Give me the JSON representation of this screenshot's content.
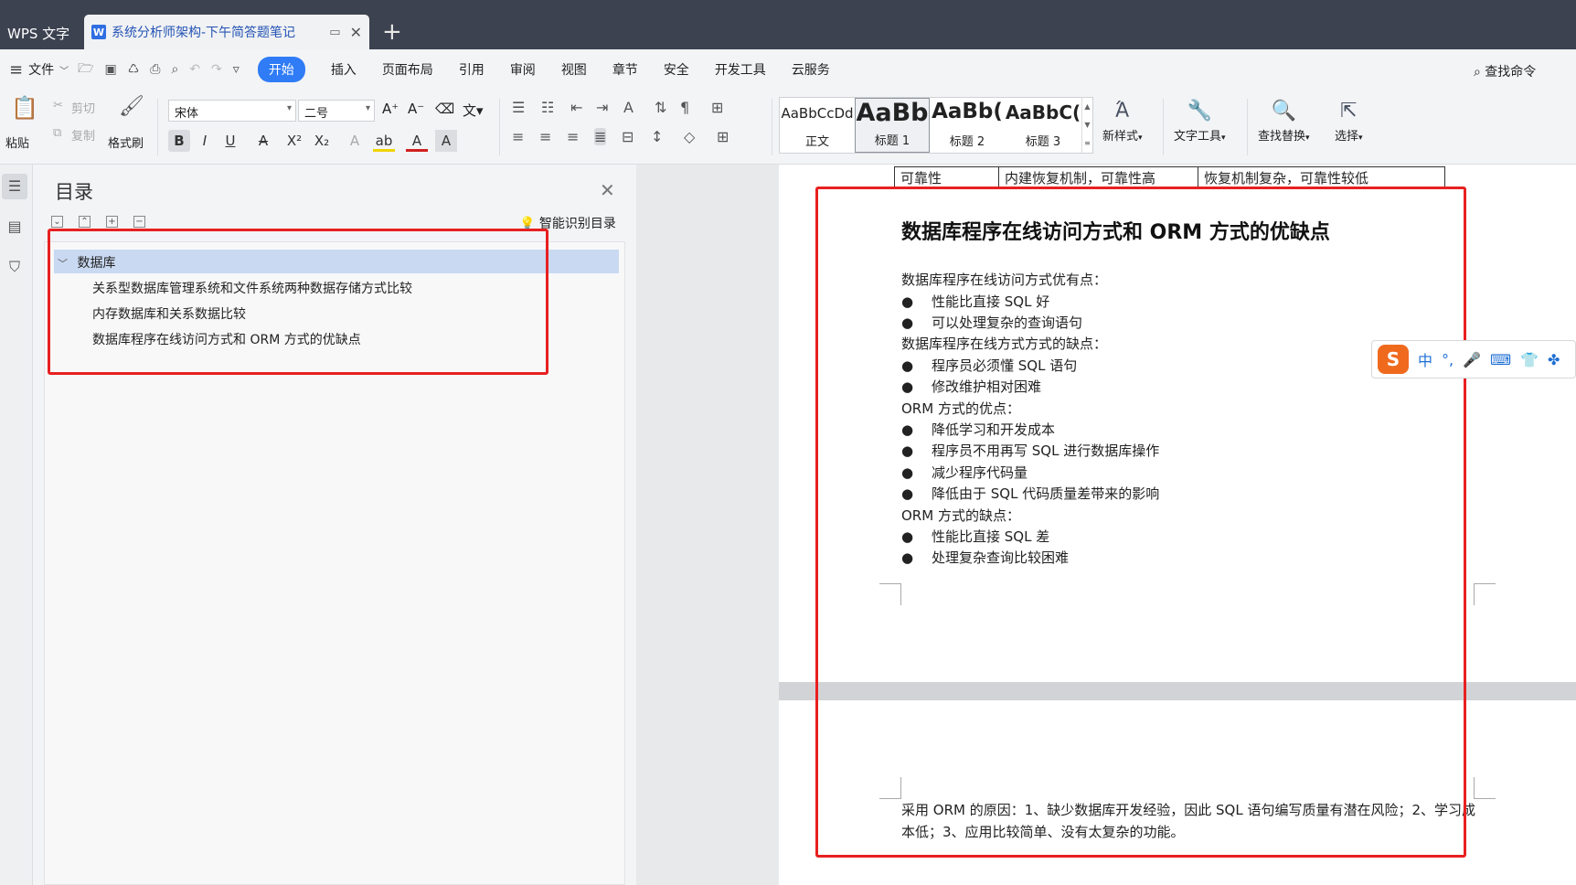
{
  "tabs": {
    "app_label": "WPS 文字",
    "doc_title": "系统分析师架构-下午简答题笔记"
  },
  "menu": {
    "file": "文件",
    "items": [
      "开始",
      "插入",
      "页面布局",
      "引用",
      "审阅",
      "视图",
      "章节",
      "安全",
      "开发工具",
      "云服务"
    ],
    "active": "开始",
    "search_command": "查找命令"
  },
  "ribbon": {
    "paste": "粘贴",
    "cut": "剪切",
    "copy": "复制",
    "format_painter": "格式刷",
    "font_name": "宋体",
    "font_size": "二号",
    "styles": [
      {
        "preview": "AaBbCcDd",
        "name": "正文"
      },
      {
        "preview": "AaBb",
        "name": "标题 1"
      },
      {
        "preview": "AaBb(",
        "name": "标题 2"
      },
      {
        "preview": "AaBbC(",
        "name": "标题 3"
      }
    ],
    "new_style": "新样式",
    "text_tools": "文字工具",
    "find_replace": "查找替换",
    "select": "选择"
  },
  "toc": {
    "title": "目录",
    "smart_toc": "智能识别目录",
    "items": [
      {
        "label": "数据库",
        "level": 1
      },
      {
        "label": "关系型数据库管理系统和文件系统两种数据存储方式比较",
        "level": 2
      },
      {
        "label": "内存数据库和关系数据比较",
        "level": 2
      },
      {
        "label": "数据库程序在线访问方式和 ORM 方式的优缺点",
        "level": 2
      }
    ]
  },
  "document": {
    "table_row": [
      "可靠性",
      "内建恢复机制，可靠性高",
      "恢复机制复杂，可靠性较低"
    ],
    "heading": "数据库程序在线访问方式和 ORM 方式的优缺点",
    "lines": [
      {
        "type": "para",
        "text": "数据库程序在线访问方式优有点："
      },
      {
        "type": "bullet",
        "text": "性能比直接 SQL 好"
      },
      {
        "type": "bullet",
        "text": "可以处理复杂的查询语句"
      },
      {
        "type": "para",
        "text": "数据库程序在线方式方式的缺点："
      },
      {
        "type": "bullet",
        "text": "程序员必须懂 SQL 语句"
      },
      {
        "type": "bullet",
        "text": "修改维护相对困难"
      },
      {
        "type": "para",
        "text": "ORM 方式的优点："
      },
      {
        "type": "bullet",
        "text": "降低学习和开发成本"
      },
      {
        "type": "bullet",
        "text": "程序员不用再写 SQL 进行数据库操作"
      },
      {
        "type": "bullet",
        "text": "减少程序代码量"
      },
      {
        "type": "bullet",
        "text": "降低由于 SQL 代码质量差带来的影响"
      },
      {
        "type": "para",
        "text": "ORM 方式的缺点："
      },
      {
        "type": "bullet",
        "text": "性能比直接 SQL 差"
      },
      {
        "type": "bullet",
        "text": "处理复杂查询比较困难"
      }
    ],
    "page2_text": "采用 ORM 的原因：1、缺少数据库开发经验，因此 SQL 语句编写质量有潜在风险；2、学习成本低；3、应用比较简单、没有太复杂的功能。"
  },
  "ime": {
    "mode": "中",
    "punct": "°,"
  },
  "colors": {
    "accent": "#2f7cf6",
    "highlight_box": "#e82020",
    "toc_selected": "#c9d9f2"
  }
}
